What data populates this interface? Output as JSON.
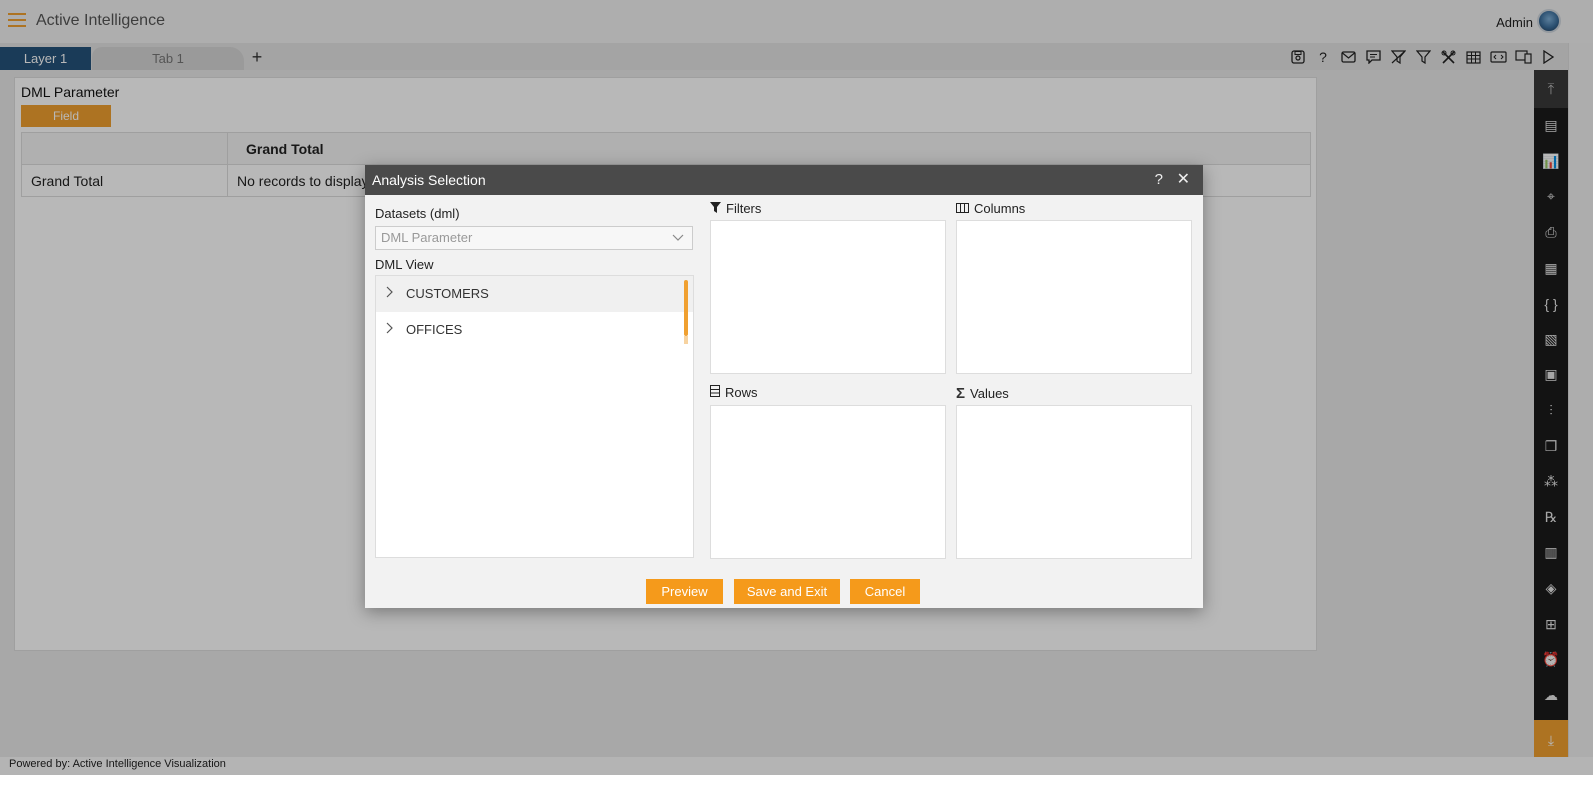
{
  "header": {
    "app_title": "Active Intelligence",
    "user_name": "Admin"
  },
  "tabs": {
    "layer": "Layer 1",
    "tab": "Tab 1",
    "add": "+"
  },
  "toolbar_icons": [
    "save-icon",
    "help-icon",
    "mail-icon",
    "comment-icon",
    "clear-filter-icon",
    "filter-icon",
    "tools-icon",
    "table-icon",
    "embed-icon",
    "devices-icon",
    "play-icon"
  ],
  "sidebar_icons": [
    "scroll-top-icon",
    "text-widget-icon",
    "chart-icon",
    "map-icon",
    "document-icon",
    "file-icon",
    "braces-icon",
    "image-icon",
    "pivot-icon",
    "bar-chart-icon",
    "copy-icon",
    "cluster-icon",
    "rx-icon",
    "report-icon",
    "layers-icon",
    "widgets-add-icon",
    "alarm-icon",
    "cloud-upload-icon",
    "download-icon"
  ],
  "report": {
    "title": "DML Parameter",
    "field_chip": "Field",
    "pivot": {
      "header": "Grand Total",
      "row_label": "Grand Total",
      "row_value": "No records to display"
    }
  },
  "modal": {
    "title": "Analysis Selection",
    "help": "?",
    "close": "✕",
    "datasets_label": "Datasets (dml)",
    "dataset_placeholder": "DML Parameter",
    "view_label": "DML View",
    "tree_items": [
      "CUSTOMERS",
      "OFFICES"
    ],
    "zones": {
      "filters": "Filters",
      "columns": "Columns",
      "rows": "Rows",
      "values": "Values"
    },
    "buttons": {
      "preview": "Preview",
      "save_exit": "Save and Exit",
      "cancel": "Cancel"
    }
  },
  "footer": {
    "text": "Powered by: Active Intelligence Visualization"
  }
}
